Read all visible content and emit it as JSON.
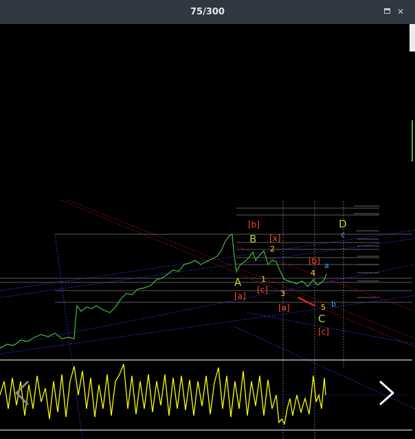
{
  "window": {
    "title": "75/300",
    "maximize_icon": "maximize-icon",
    "close_icon": "close-icon"
  },
  "navigation": {
    "prev_icon": "chevron-left-icon",
    "next_icon": "chevron-right-icon"
  },
  "chart": {
    "wave_labels": {
      "A": "A",
      "B": "B",
      "C": "C",
      "D": "D",
      "b_bracket": "[b]",
      "x_bracket": "[x]",
      "a_bracket": "[a]",
      "c_bracket": "[c]",
      "a2_bracket": "[a]",
      "b2_bracket": "[b]",
      "c2_bracket": "[c]",
      "one": "1",
      "two": "2",
      "three": "3",
      "four": "4",
      "five": "5",
      "small_a": "a",
      "small_b": "b",
      "small_c": "c"
    },
    "colors": {
      "price_line": "#3fbf3f",
      "oscillator_line": "#ffff00",
      "wave_major": "#b5d334",
      "wave_bracket": "#ff4a1a",
      "wave_minor": "#ffd21f",
      "wave_small": "#33a7ff",
      "trend_red": "#e02020",
      "channel_blue": "#3a3aff"
    }
  }
}
